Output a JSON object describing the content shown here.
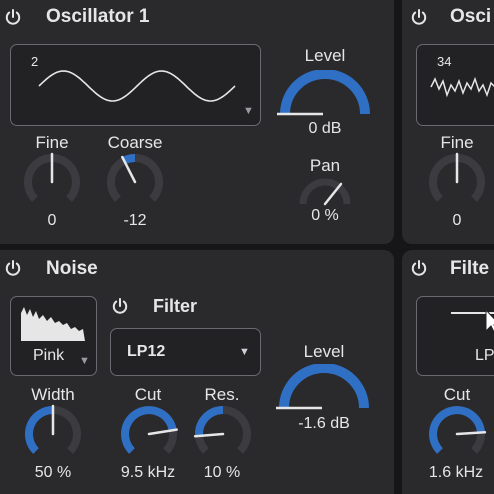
{
  "colors": {
    "accent": "#2f6fc4",
    "panel": "#2a2a2d",
    "background": "#161618",
    "track": "#3b3b40",
    "text": "#e6e6e6"
  },
  "osc1": {
    "title": "Oscillator 1",
    "wave_number": "2",
    "fine_label": "Fine",
    "fine_value": "0",
    "coarse_label": "Coarse",
    "coarse_value": "-12",
    "level_label": "Level",
    "level_value": "0 dB",
    "pan_label": "Pan",
    "pan_value": "0 %"
  },
  "osc2": {
    "title": "Osci",
    "wave_number": "34",
    "fine_label": "Fine",
    "fine_value": "0"
  },
  "noise": {
    "title": "Noise",
    "color_value": "Pink",
    "width_label": "Width",
    "width_value": "50 %"
  },
  "filter": {
    "title": "Filter",
    "type_value": "LP12",
    "cut_label": "Cut",
    "cut_value": "9.5 kHz",
    "res_label": "Res.",
    "res_value": "10 %",
    "level_label": "Level",
    "level_value": "-1.6 dB"
  },
  "filter2": {
    "title": "Filte",
    "type_value": "LP",
    "cut_label": "Cut",
    "cut_value": "1.6 kHz"
  },
  "icons": [
    "power-icon",
    "dropdown-triangle-icon",
    "noise-spectrum-icon",
    "waveform-icon",
    "mouse-cursor-icon"
  ]
}
